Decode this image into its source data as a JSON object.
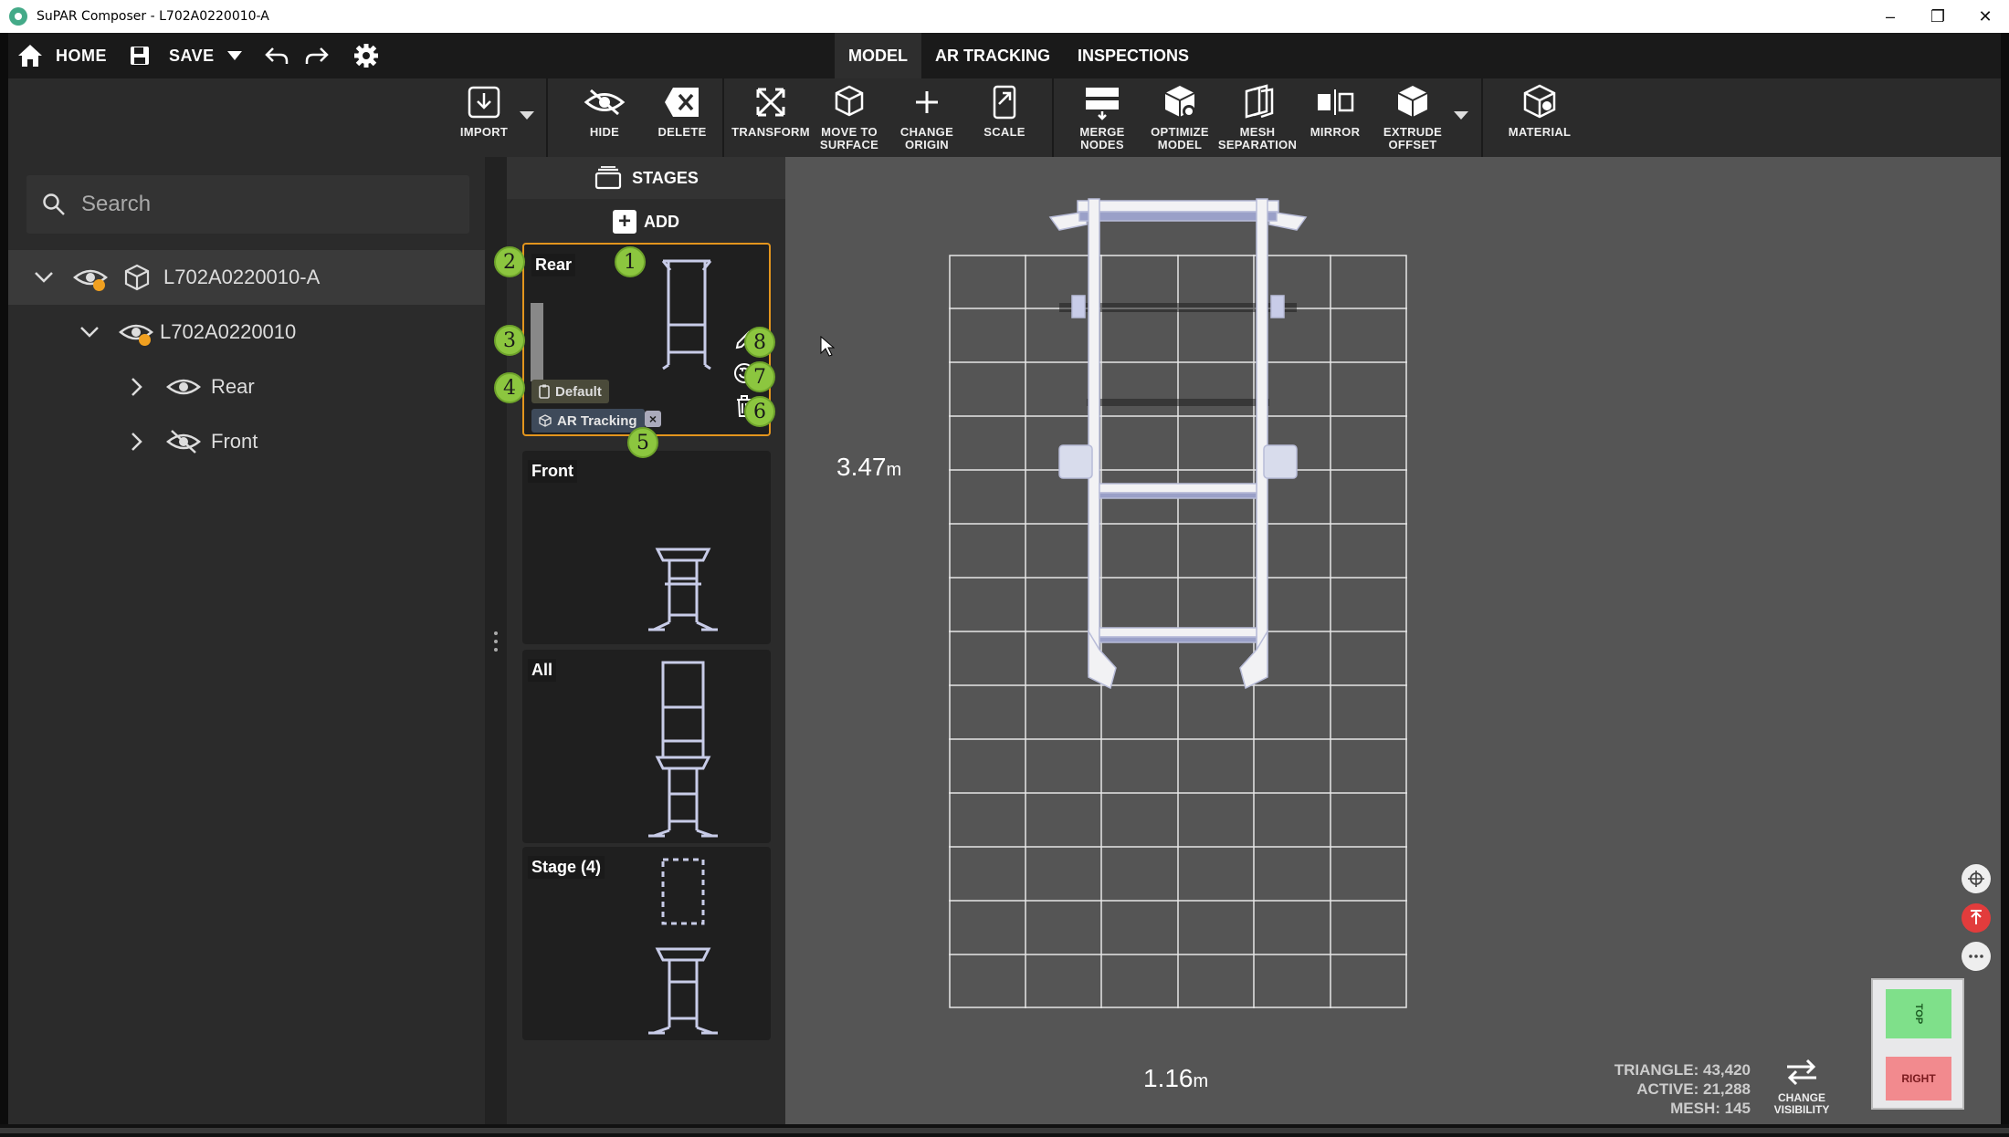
{
  "window": {
    "title": "SuPAR Composer - L702A0220010-A",
    "controls": [
      "–",
      "❐",
      "✕"
    ]
  },
  "topnav": {
    "home_label": "HOME",
    "save_label": "SAVE",
    "tabs": [
      {
        "label": "MODEL",
        "active": true
      },
      {
        "label": "AR TRACKING",
        "active": false
      },
      {
        "label": "INSPECTIONS",
        "active": false
      }
    ]
  },
  "toolbar": {
    "import": "IMPORT",
    "hide": "HIDE",
    "delete": "DELETE",
    "transform": "TRANSFORM",
    "move_to_surface_1": "MOVE TO",
    "move_to_surface_2": "SURFACE",
    "change_origin_1": "CHANGE",
    "change_origin_2": "ORIGIN",
    "scale": "SCALE",
    "merge_nodes_1": "MERGE",
    "merge_nodes_2": "NODES",
    "optimize_model_1": "OPTIMIZE",
    "optimize_model_2": "MODEL",
    "mesh_separation_1": "MESH",
    "mesh_separation_2": "SEPARATION",
    "mirror": "MIRROR",
    "extrude_offset_1": "EXTRUDE",
    "extrude_offset_2": "OFFSET",
    "material": "MATERIAL"
  },
  "search": {
    "placeholder": "Search"
  },
  "tree": {
    "root": "L702A0220010-A",
    "child": "L702A0220010",
    "items": [
      "Rear",
      "Front"
    ]
  },
  "stages": {
    "header": "STAGES",
    "add_label": "ADD",
    "cards": [
      {
        "name": "Rear",
        "default_label": "Default",
        "tracking_label": "AR Tracking"
      },
      {
        "name": "Front"
      },
      {
        "name": "All"
      },
      {
        "name": "Stage (4)"
      }
    ],
    "callouts": [
      "1",
      "2",
      "3",
      "4",
      "5",
      "6",
      "7",
      "8"
    ]
  },
  "viewport": {
    "height_value": "3.47",
    "width_value": "1.16",
    "unit": "m",
    "stats": {
      "triangle": "TRIANGLE: 43,420",
      "active": "ACTIVE: 21,288",
      "mesh": "MESH: 145"
    },
    "change_vis_1": "CHANGE",
    "change_vis_2": "VISIBILITY",
    "cube_top": "TOP",
    "cube_right": "RIGHT"
  },
  "colors": {
    "accent_orange": "#e3951d",
    "callout_green": "#8cc63f",
    "cube_top": "#7fe08a",
    "cube_right": "#f28a8e",
    "warn": "#f0a020"
  }
}
